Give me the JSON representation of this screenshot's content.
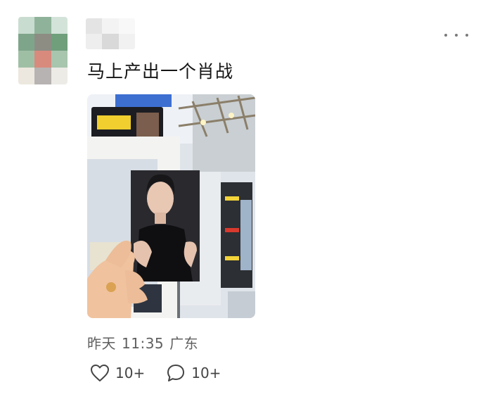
{
  "post": {
    "text": "马上产出一个肖战",
    "time_label": "昨天",
    "time": "11:35",
    "location": "广东"
  },
  "actions": {
    "like_icon": "heart-icon",
    "like_count": "10+",
    "comment_icon": "comment-icon",
    "comment_count": "10+"
  },
  "menu": {
    "icon": "more-dots-icon"
  },
  "colors": {
    "text_primary": "#151515",
    "text_secondary": "#5f5f5f",
    "icon": "#444444"
  }
}
